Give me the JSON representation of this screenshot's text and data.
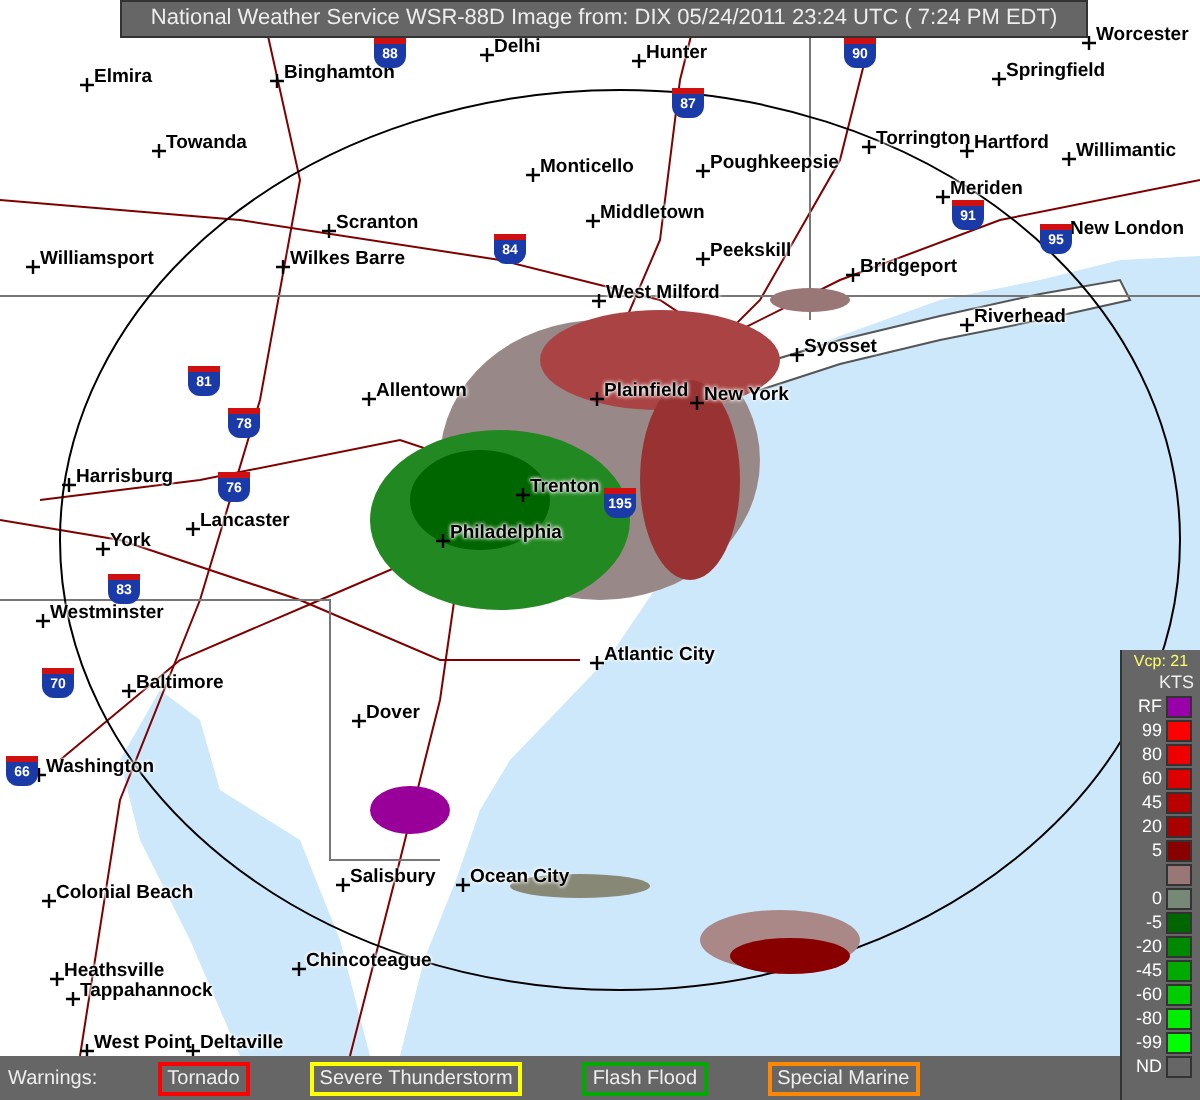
{
  "title": "National Weather Service WSR-88D Image from: DIX 05/24/2011 23:24 UTC ( 7:24 PM EDT)",
  "cities": [
    "Delhi",
    "Hunter",
    "Worcester",
    "Elmira",
    "Binghamton",
    "Springfield",
    "Towanda",
    "Torrington",
    "Hartford",
    "Willimantic",
    "Monticello",
    "Poughkeepsie",
    "Meriden",
    "Scranton",
    "Middletown",
    "New London",
    "Williamsport",
    "Wilkes Barre",
    "Peekskill",
    "Bridgeport",
    "West Milford",
    "Riverhead",
    "Syosset",
    "Allentown",
    "Plainfield",
    "New York",
    "Harrisburg",
    "Trenton",
    "York",
    "Lancaster",
    "Philadelphia",
    "Westminster",
    "Atlantic City",
    "Baltimore",
    "Dover",
    "Washington",
    "Colonial Beach",
    "Salisbury",
    "Ocean City",
    "Heathsville",
    "Chincoteague",
    "Tappahannock",
    "West Point",
    "Deltaville"
  ],
  "interstates": [
    "88",
    "87",
    "90",
    "84",
    "91",
    "95",
    "81",
    "78",
    "76",
    "195",
    "83",
    "70",
    "66"
  ],
  "legend": {
    "vcp": "Vcp: 21",
    "unit": "KTS",
    "levels": [
      {
        "label": "RF",
        "color": "#9900aa"
      },
      {
        "label": "99",
        "color": "#ff0000"
      },
      {
        "label": "80",
        "color": "#ee0000"
      },
      {
        "label": "60",
        "color": "#dd0000"
      },
      {
        "label": "45",
        "color": "#bb0000"
      },
      {
        "label": "20",
        "color": "#aa0000"
      },
      {
        "label": "5",
        "color": "#880000"
      },
      {
        "color": "#997777"
      },
      {
        "label": "0",
        "color": "#778877"
      },
      {
        "label": "-5",
        "color": "#006600"
      },
      {
        "label": "-20",
        "color": "#008800"
      },
      {
        "label": "-45",
        "color": "#00aa00"
      },
      {
        "label": "-60",
        "color": "#00cc00"
      },
      {
        "label": "-80",
        "color": "#00ee00"
      },
      {
        "label": "-99",
        "color": "#00ff00"
      },
      {
        "label": "ND",
        "color": "#666666"
      }
    ]
  },
  "warnings": {
    "label": "Warnings:",
    "items": [
      {
        "label": "Tornado",
        "color": "#ff0000"
      },
      {
        "label": "Severe Thunderstorm",
        "color": "#ffff00"
      },
      {
        "label": "Flash Flood",
        "color": "#00aa00"
      },
      {
        "label": "Special Marine",
        "color": "#ff8800"
      }
    ]
  }
}
